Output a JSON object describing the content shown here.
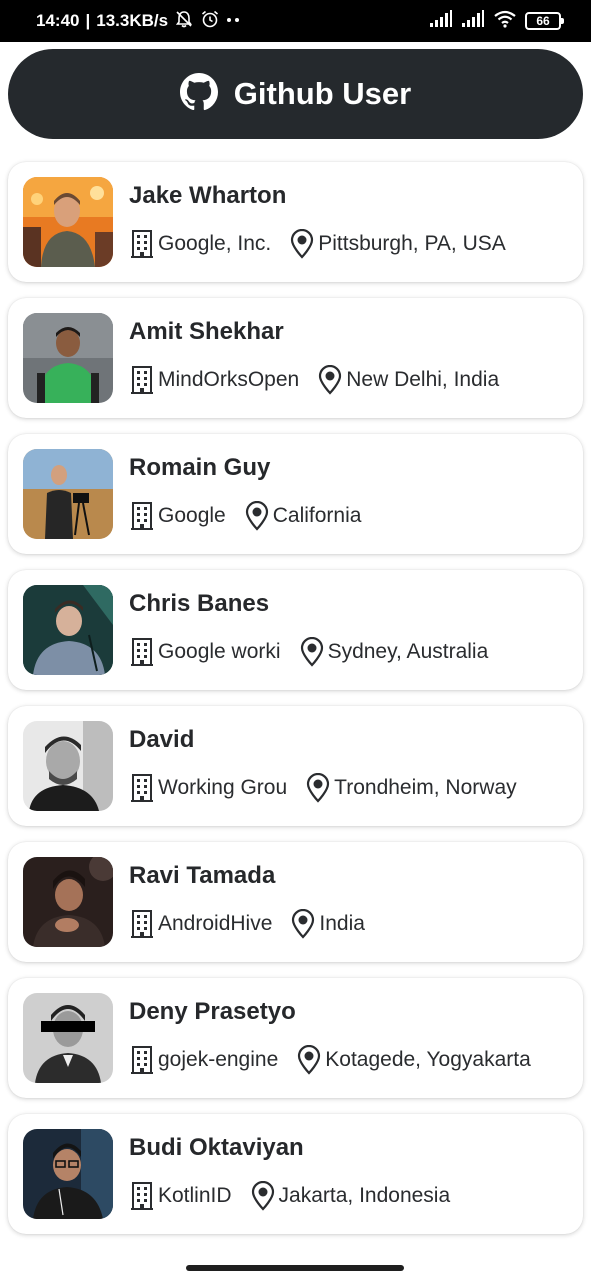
{
  "status_bar": {
    "time": "14:40",
    "speed": "13.3KB/s",
    "icons": [
      "bell-off-icon",
      "alarm-icon",
      "more-dots-icon",
      "cell-signal-icon",
      "cell-signal-icon",
      "wifi-icon"
    ],
    "battery": "66"
  },
  "header": {
    "title": "Github User",
    "icon": "github-icon",
    "background": "#25292d"
  },
  "users": [
    {
      "name": "Jake Wharton",
      "company": "Google, Inc.",
      "location": "Pittsburgh, PA, USA"
    },
    {
      "name": "Amit Shekhar",
      "company": "MindOrksOpen",
      "location": "New Delhi, India"
    },
    {
      "name": "Romain Guy",
      "company": "Google",
      "location": "California"
    },
    {
      "name": "Chris Banes",
      "company": "Google worki",
      "location": "Sydney, Australia"
    },
    {
      "name": "David",
      "company": "Working Grou",
      "location": "Trondheim, Norway"
    },
    {
      "name": "Ravi Tamada",
      "company": "AndroidHive",
      "location": "India"
    },
    {
      "name": "Deny Prasetyo",
      "company": "gojek-engine",
      "location": "Kotagede, Yogyakarta"
    },
    {
      "name": "Budi Oktaviyan",
      "company": "KotlinID",
      "location": "Jakarta, Indonesia"
    }
  ],
  "icons": {
    "company": "building-icon",
    "location": "location-pin-icon"
  }
}
